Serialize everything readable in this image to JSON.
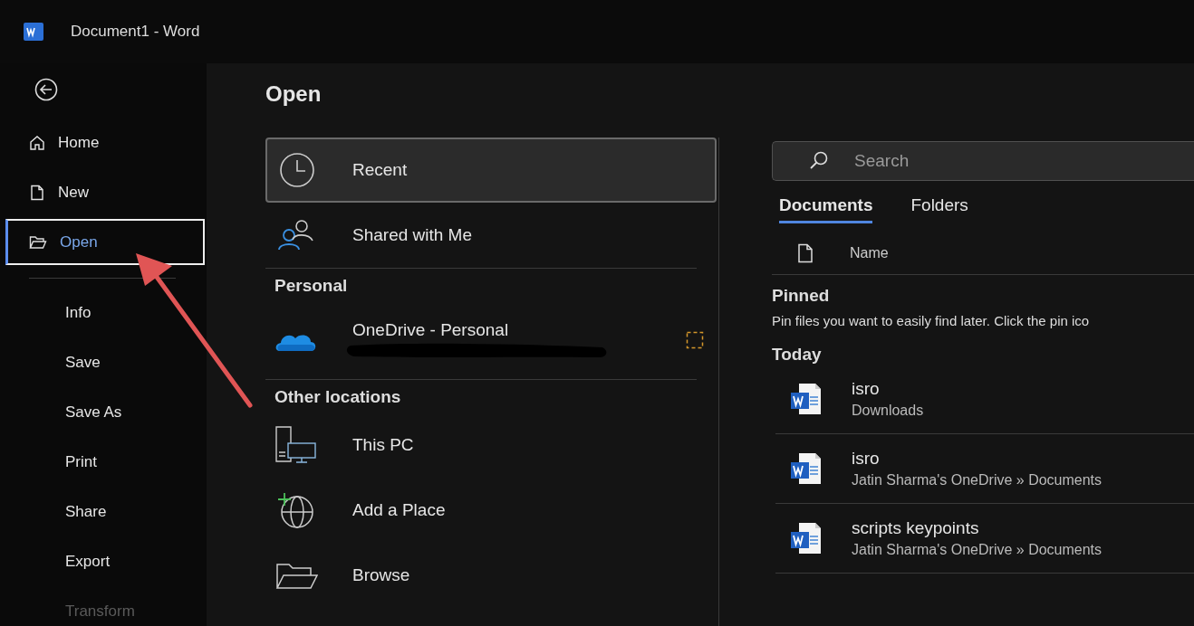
{
  "title_bar": {
    "title": "Document1  -  Word"
  },
  "sidebar": {
    "items": [
      {
        "label": "Home",
        "kind": "primary",
        "selected": false,
        "disabled": false,
        "highlighted": false
      },
      {
        "label": "New",
        "kind": "primary",
        "selected": false,
        "disabled": false,
        "highlighted": false
      },
      {
        "label": "Open",
        "kind": "primary",
        "selected": true,
        "disabled": false,
        "highlighted": true
      },
      {
        "label": "Info",
        "kind": "secondary",
        "selected": false,
        "disabled": false,
        "highlighted": false
      },
      {
        "label": "Save",
        "kind": "secondary",
        "selected": false,
        "disabled": false,
        "highlighted": false
      },
      {
        "label": "Save As",
        "kind": "secondary",
        "selected": false,
        "disabled": false,
        "highlighted": false
      },
      {
        "label": "Print",
        "kind": "secondary",
        "selected": false,
        "disabled": false,
        "highlighted": false
      },
      {
        "label": "Share",
        "kind": "secondary",
        "selected": false,
        "disabled": false,
        "highlighted": false
      },
      {
        "label": "Export",
        "kind": "secondary",
        "selected": false,
        "disabled": false,
        "highlighted": false
      },
      {
        "label": "Transform",
        "kind": "secondary",
        "selected": false,
        "disabled": true,
        "highlighted": false
      }
    ]
  },
  "main": {
    "heading": "Open",
    "locations": [
      {
        "kind": "place",
        "label": "Recent",
        "selected": true
      },
      {
        "kind": "place",
        "label": "Shared with Me",
        "selected": false
      },
      {
        "kind": "heading",
        "label": "Personal"
      },
      {
        "kind": "account",
        "label": "OneDrive - Personal",
        "selected": false
      },
      {
        "kind": "heading",
        "label": "Other locations"
      },
      {
        "kind": "place",
        "label": "This PC",
        "selected": false
      },
      {
        "kind": "place",
        "label": "Add a Place",
        "selected": false
      },
      {
        "kind": "place",
        "label": "Browse",
        "selected": false
      }
    ],
    "search": {
      "placeholder": "Search"
    },
    "tabs": [
      {
        "label": "Documents",
        "selected": true
      },
      {
        "label": "Folders",
        "selected": false
      }
    ],
    "column_header": "Name",
    "pinned": {
      "heading": "Pinned",
      "hint": "Pin files you want to easily find later. Click the pin ico"
    },
    "today": {
      "heading": "Today",
      "files": [
        {
          "name": "isro",
          "location": "Downloads"
        },
        {
          "name": "isro",
          "location": "Jatin Sharma's OneDrive » Documents"
        },
        {
          "name": "scripts keypoints",
          "location": "Jatin Sharma's OneDrive » Documents"
        }
      ]
    }
  }
}
